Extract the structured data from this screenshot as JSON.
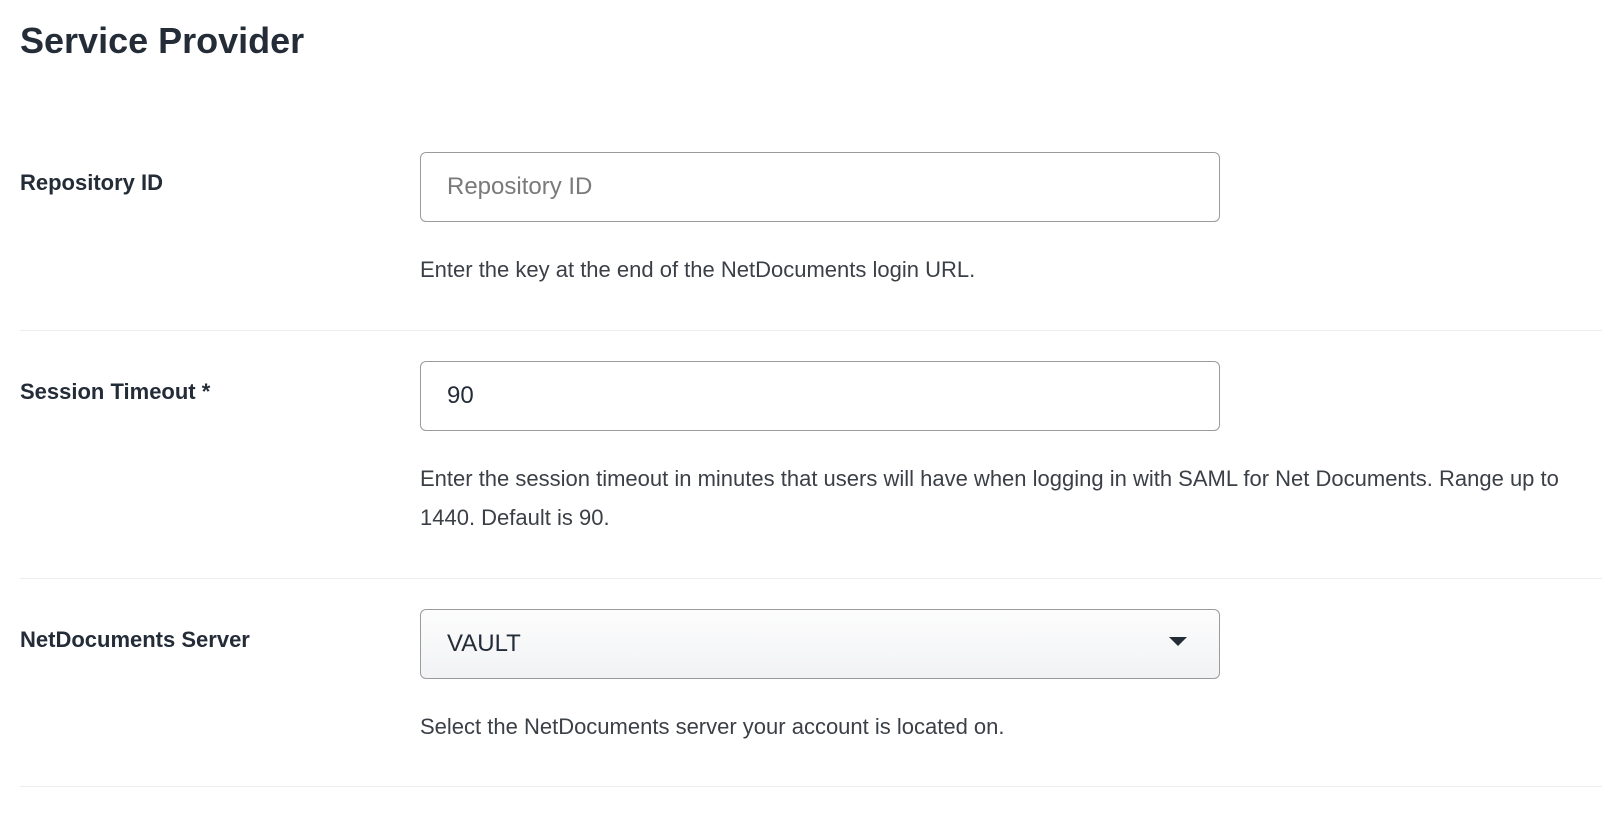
{
  "section_title": "Service Provider",
  "fields": {
    "repository_id": {
      "label": "Repository ID",
      "placeholder": "Repository ID",
      "value": "",
      "help": "Enter the key at the end of the NetDocuments login URL."
    },
    "session_timeout": {
      "label": "Session Timeout *",
      "value": "90",
      "help": "Enter the session timeout in minutes that users will have when logging in with SAML for Net Documents. Range up to 1440. Default is 90."
    },
    "server": {
      "label": "NetDocuments Server",
      "selected": "VAULT",
      "help": "Select the NetDocuments server your account is located on."
    }
  }
}
